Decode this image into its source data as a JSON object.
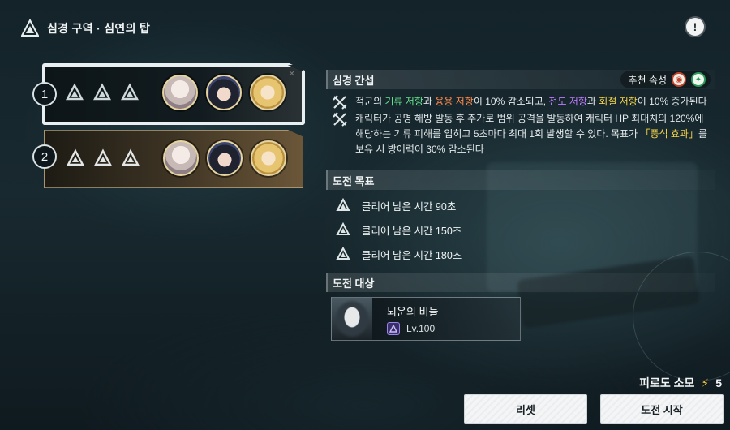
{
  "header": {
    "title": "심경 구역 · 심연의 탑"
  },
  "stages": [
    {
      "number": "1",
      "selected": true
    },
    {
      "number": "2",
      "selected": false
    }
  ],
  "interference": {
    "heading": "심경 간섭",
    "recommend_label": "추천 속성",
    "effects": {
      "e1": {
        "p1": "적군의 ",
        "h1": "기류 저항",
        "p2": "과 ",
        "h2": "융용 저항",
        "p3": "이 10% 감소되고, ",
        "h3": "전도 저항",
        "p4": "과 ",
        "h4": "회절 저항",
        "p5": "이 10% 증가된다"
      },
      "e2": {
        "p1": "캐릭터가 공명 해방 발동 후 추가로 범위 공격을 발동하여 캐릭터 HP 최대치의 120%에 해당하는 기류 피해를 입히고 5초마다 최대 1회 발생할 수 있다. 목표가 ",
        "h1": "「풍식 효과」",
        "p2": "를 보유 시 방어력이 30% 감소된다"
      }
    }
  },
  "goals": {
    "heading": "도전 목표",
    "items": [
      {
        "label": "클리어 남은 시간 90초"
      },
      {
        "label": "클리어 남은 시간 150초"
      },
      {
        "label": "클리어 남은 시간 180초"
      }
    ]
  },
  "target": {
    "heading": "도전 대상",
    "name": "뇌운의 비늘",
    "level": "Lv.100"
  },
  "footer": {
    "stamina_label": "피로도 소모",
    "stamina_value": "5",
    "reset_label": "리셋",
    "start_label": "도전 시작"
  },
  "colors": {
    "aero": "#66e08c",
    "fusion": "#ff8a4c",
    "electro": "#c07bff",
    "spectro": "#f2d34a"
  }
}
